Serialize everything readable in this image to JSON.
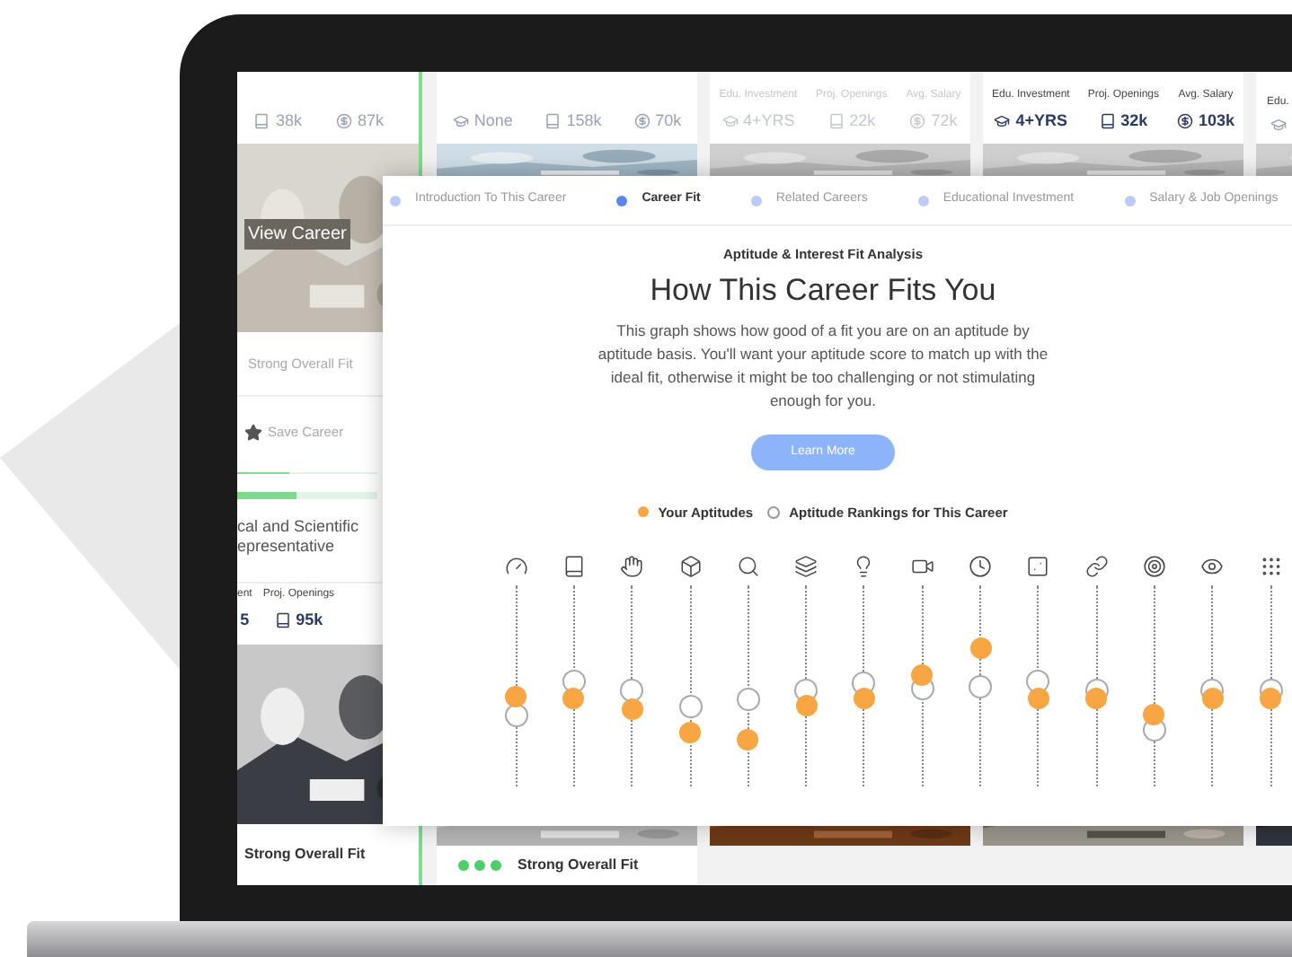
{
  "cards": [
    {
      "stats": [
        {
          "kind": "book",
          "value": "38k"
        },
        {
          "kind": "dollar",
          "value": "87k"
        }
      ],
      "view_button": "View Career",
      "fit": "Strong Overall Fit",
      "save": "Save Career",
      "fit_bars": [
        {
          "level": 0.37
        },
        {
          "level": 0.42
        }
      ],
      "title_lines": [
        "cal and Scientific",
        "epresentative"
      ],
      "stats2": [
        {
          "label": "ent",
          "value": "5"
        },
        {
          "label": "Proj. Openings",
          "kind": "book",
          "value": "95k"
        }
      ],
      "footer": {
        "text": "Strong Overall Fit"
      }
    },
    {
      "stats": [
        {
          "kind": "cap",
          "value": "None"
        },
        {
          "kind": "book",
          "value": "158k"
        },
        {
          "kind": "dollar",
          "value": "70k"
        }
      ],
      "footer": {
        "text": "Strong Overall Fit",
        "kind": "dots"
      }
    },
    {
      "stats": [
        {
          "label": "Edu. Investment",
          "kind": "cap",
          "value": "4+YRS"
        },
        {
          "label": "Proj. Openings",
          "kind": "book",
          "value": "22k"
        },
        {
          "label": "Avg. Salary",
          "kind": "dollar",
          "value": "72k"
        }
      ],
      "faded": true
    },
    {
      "stats": [
        {
          "label": "Edu. Investment",
          "kind": "cap",
          "value": "4+YRS"
        },
        {
          "label": "Proj. Openings",
          "kind": "book",
          "value": "32k"
        },
        {
          "label": "Avg. Salary",
          "kind": "dollar",
          "value": "103k"
        }
      ],
      "faded": false
    },
    {
      "stats": [
        {
          "label": "Edu.",
          "kind": "cap"
        }
      ]
    }
  ],
  "modal": {
    "tabs": [
      {
        "label": "Introduction To This Career",
        "selected": false
      },
      {
        "label": "Career Fit",
        "selected": true
      },
      {
        "label": "Related Careers",
        "selected": false
      },
      {
        "label": "Educational Investment",
        "selected": false
      },
      {
        "label": "Salary & Job Openings",
        "selected": false
      }
    ],
    "eyebrow": "Aptitude & Interest Fit Analysis",
    "title": "How This Career Fits You",
    "description": "This graph shows how good of a fit you are on an aptitude by aptitude basis. You'll want your aptitude score to match up with the ideal fit, otherwise it might be too challenging or not stimulating enough for you.",
    "button": "Learn More",
    "legend": [
      {
        "kind": "filled",
        "label": "Your Aptitudes"
      },
      {
        "kind": "hollow",
        "label": "Aptitude Rankings for This Career"
      }
    ],
    "aptitudes": [
      {
        "kind": "gauge",
        "you": {
          "level": 0.45
        },
        "career": {
          "level": 0.35
        }
      },
      {
        "kind": "book",
        "you": {
          "level": 0.44
        },
        "career": {
          "level": 0.52
        }
      },
      {
        "kind": "hand",
        "you": {
          "level": 0.38
        },
        "career": {
          "level": 0.48
        }
      },
      {
        "kind": "cube",
        "you": {
          "level": 0.27
        },
        "career": {
          "level": 0.4
        }
      },
      {
        "kind": "search",
        "you": {
          "level": 0.23
        },
        "career": {
          "level": 0.43
        }
      },
      {
        "kind": "layers",
        "you": {
          "level": 0.4
        },
        "career": {
          "level": 0.48
        }
      },
      {
        "kind": "bulb",
        "you": {
          "level": 0.44
        },
        "career": {
          "level": 0.51
        }
      },
      {
        "kind": "camera",
        "you": {
          "level": 0.55
        },
        "career": {
          "level": 0.49
        }
      },
      {
        "kind": "clock",
        "you": {
          "level": 0.69
        },
        "career": {
          "level": 0.5
        }
      },
      {
        "kind": "dice",
        "you": {
          "level": 0.44
        },
        "career": {
          "level": 0.52
        }
      },
      {
        "kind": "link",
        "you": {
          "level": 0.44
        },
        "career": {
          "level": 0.48
        }
      },
      {
        "kind": "target",
        "you": {
          "level": 0.36
        },
        "career": {
          "level": 0.28
        }
      },
      {
        "kind": "eye",
        "you": {
          "level": 0.44
        },
        "career": {
          "level": 0.48
        }
      },
      {
        "kind": "grid",
        "you": {
          "level": 0.44
        },
        "career": {
          "level": 0.48
        }
      }
    ]
  }
}
